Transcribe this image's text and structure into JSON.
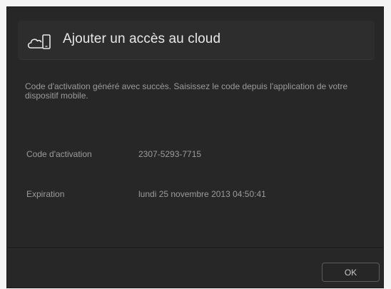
{
  "dialog": {
    "title": "Ajouter un accès au cloud",
    "icon": "cloud-mobile-icon",
    "message": "Code d'activation généré avec succès. Saisissez le code depuis l'application de votre dispositif mobile.",
    "fields": [
      {
        "label": "Code d'activation",
        "value": "2307-5293-7715"
      },
      {
        "label": "Expiration",
        "value": "lundi 25 novembre 2013 04:50:41"
      }
    ],
    "ok_label": "OK"
  },
  "colors": {
    "dialog_background": "#272727",
    "header_background": "#2d2d2d",
    "title_text": "#e8e8e8",
    "body_text": "#9b9b9b"
  }
}
